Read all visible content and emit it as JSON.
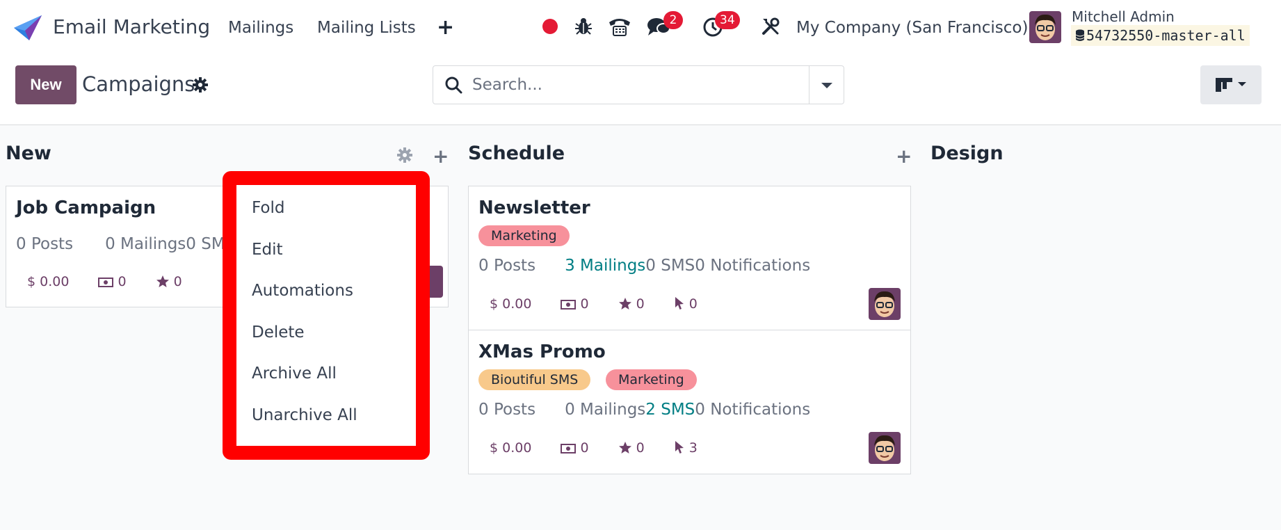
{
  "app": {
    "name": "Email Marketing"
  },
  "nav": {
    "items": [
      "Mailings",
      "Mailing Lists"
    ],
    "add_label": "+"
  },
  "systray": {
    "messages_count": "2",
    "activities_count": "34",
    "company": "My Company (San Francisco)",
    "user_name": "Mitchell Admin",
    "database": "54732550-master-all",
    "icons": [
      "record-icon",
      "bug-icon",
      "phone-icon",
      "chat-icon",
      "clock-icon",
      "tools-icon"
    ]
  },
  "control": {
    "new_label": "New",
    "title": "Campaigns",
    "search_placeholder": "Search..."
  },
  "columns": [
    {
      "title": "New"
    },
    {
      "title": "Schedule"
    },
    {
      "title": "Design"
    }
  ],
  "cards": {
    "job": {
      "title": "Job Campaign",
      "posts": "0 Posts",
      "mailings": "0 Mailings",
      "sms": "0 SMS",
      "revenue": "$ 0.00",
      "quotations": "0",
      "rating": "0"
    },
    "newsletter": {
      "title": "Newsletter",
      "tags": [
        "Marketing"
      ],
      "posts": "0 Posts",
      "mailings": "3 Mailings",
      "sms": "0 SMS",
      "notifications": "0 Notifications",
      "revenue": "$ 0.00",
      "quotations": "0",
      "rating": "0",
      "clicks": "0"
    },
    "xmas": {
      "title": "XMas Promo",
      "tags": [
        "Bioutiful SMS",
        "Marketing"
      ],
      "posts": "0 Posts",
      "mailings": "0 Mailings",
      "sms": "2 SMS",
      "notifications": "0 Notifications",
      "revenue": "$ 0.00",
      "quotations": "0",
      "rating": "0",
      "clicks": "3"
    }
  },
  "dropdown": {
    "items": [
      "Fold",
      "Edit",
      "Automations",
      "Delete",
      "Archive All",
      "Unarchive All"
    ]
  },
  "colors": {
    "brand": "#714b67",
    "badge": "#e41a35",
    "highlight": "#ff0000",
    "link": "#017e84",
    "tag_marketing": "#f7919b",
    "tag_sms": "#f8c98b"
  }
}
